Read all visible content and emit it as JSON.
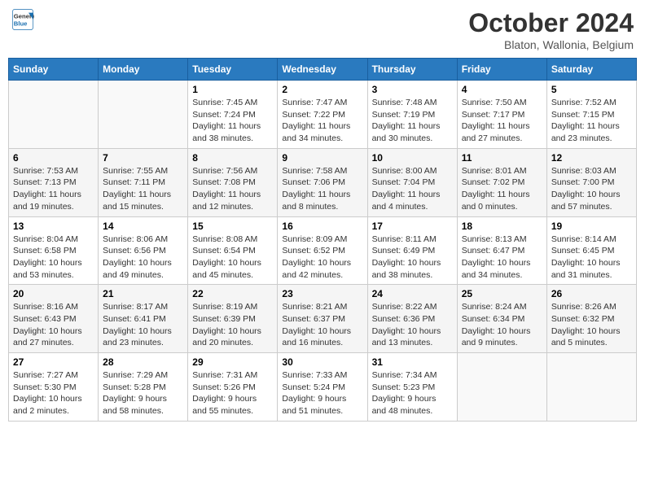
{
  "header": {
    "logo_line1": "General",
    "logo_line2": "Blue",
    "month": "October 2024",
    "location": "Blaton, Wallonia, Belgium"
  },
  "weekdays": [
    "Sunday",
    "Monday",
    "Tuesday",
    "Wednesday",
    "Thursday",
    "Friday",
    "Saturday"
  ],
  "weeks": [
    [
      {
        "day": "",
        "sunrise": "",
        "sunset": "",
        "daylight": ""
      },
      {
        "day": "",
        "sunrise": "",
        "sunset": "",
        "daylight": ""
      },
      {
        "day": "1",
        "sunrise": "Sunrise: 7:45 AM",
        "sunset": "Sunset: 7:24 PM",
        "daylight": "Daylight: 11 hours and 38 minutes."
      },
      {
        "day": "2",
        "sunrise": "Sunrise: 7:47 AM",
        "sunset": "Sunset: 7:22 PM",
        "daylight": "Daylight: 11 hours and 34 minutes."
      },
      {
        "day": "3",
        "sunrise": "Sunrise: 7:48 AM",
        "sunset": "Sunset: 7:19 PM",
        "daylight": "Daylight: 11 hours and 30 minutes."
      },
      {
        "day": "4",
        "sunrise": "Sunrise: 7:50 AM",
        "sunset": "Sunset: 7:17 PM",
        "daylight": "Daylight: 11 hours and 27 minutes."
      },
      {
        "day": "5",
        "sunrise": "Sunrise: 7:52 AM",
        "sunset": "Sunset: 7:15 PM",
        "daylight": "Daylight: 11 hours and 23 minutes."
      }
    ],
    [
      {
        "day": "6",
        "sunrise": "Sunrise: 7:53 AM",
        "sunset": "Sunset: 7:13 PM",
        "daylight": "Daylight: 11 hours and 19 minutes."
      },
      {
        "day": "7",
        "sunrise": "Sunrise: 7:55 AM",
        "sunset": "Sunset: 7:11 PM",
        "daylight": "Daylight: 11 hours and 15 minutes."
      },
      {
        "day": "8",
        "sunrise": "Sunrise: 7:56 AM",
        "sunset": "Sunset: 7:08 PM",
        "daylight": "Daylight: 11 hours and 12 minutes."
      },
      {
        "day": "9",
        "sunrise": "Sunrise: 7:58 AM",
        "sunset": "Sunset: 7:06 PM",
        "daylight": "Daylight: 11 hours and 8 minutes."
      },
      {
        "day": "10",
        "sunrise": "Sunrise: 8:00 AM",
        "sunset": "Sunset: 7:04 PM",
        "daylight": "Daylight: 11 hours and 4 minutes."
      },
      {
        "day": "11",
        "sunrise": "Sunrise: 8:01 AM",
        "sunset": "Sunset: 7:02 PM",
        "daylight": "Daylight: 11 hours and 0 minutes."
      },
      {
        "day": "12",
        "sunrise": "Sunrise: 8:03 AM",
        "sunset": "Sunset: 7:00 PM",
        "daylight": "Daylight: 10 hours and 57 minutes."
      }
    ],
    [
      {
        "day": "13",
        "sunrise": "Sunrise: 8:04 AM",
        "sunset": "Sunset: 6:58 PM",
        "daylight": "Daylight: 10 hours and 53 minutes."
      },
      {
        "day": "14",
        "sunrise": "Sunrise: 8:06 AM",
        "sunset": "Sunset: 6:56 PM",
        "daylight": "Daylight: 10 hours and 49 minutes."
      },
      {
        "day": "15",
        "sunrise": "Sunrise: 8:08 AM",
        "sunset": "Sunset: 6:54 PM",
        "daylight": "Daylight: 10 hours and 45 minutes."
      },
      {
        "day": "16",
        "sunrise": "Sunrise: 8:09 AM",
        "sunset": "Sunset: 6:52 PM",
        "daylight": "Daylight: 10 hours and 42 minutes."
      },
      {
        "day": "17",
        "sunrise": "Sunrise: 8:11 AM",
        "sunset": "Sunset: 6:49 PM",
        "daylight": "Daylight: 10 hours and 38 minutes."
      },
      {
        "day": "18",
        "sunrise": "Sunrise: 8:13 AM",
        "sunset": "Sunset: 6:47 PM",
        "daylight": "Daylight: 10 hours and 34 minutes."
      },
      {
        "day": "19",
        "sunrise": "Sunrise: 8:14 AM",
        "sunset": "Sunset: 6:45 PM",
        "daylight": "Daylight: 10 hours and 31 minutes."
      }
    ],
    [
      {
        "day": "20",
        "sunrise": "Sunrise: 8:16 AM",
        "sunset": "Sunset: 6:43 PM",
        "daylight": "Daylight: 10 hours and 27 minutes."
      },
      {
        "day": "21",
        "sunrise": "Sunrise: 8:17 AM",
        "sunset": "Sunset: 6:41 PM",
        "daylight": "Daylight: 10 hours and 23 minutes."
      },
      {
        "day": "22",
        "sunrise": "Sunrise: 8:19 AM",
        "sunset": "Sunset: 6:39 PM",
        "daylight": "Daylight: 10 hours and 20 minutes."
      },
      {
        "day": "23",
        "sunrise": "Sunrise: 8:21 AM",
        "sunset": "Sunset: 6:37 PM",
        "daylight": "Daylight: 10 hours and 16 minutes."
      },
      {
        "day": "24",
        "sunrise": "Sunrise: 8:22 AM",
        "sunset": "Sunset: 6:36 PM",
        "daylight": "Daylight: 10 hours and 13 minutes."
      },
      {
        "day": "25",
        "sunrise": "Sunrise: 8:24 AM",
        "sunset": "Sunset: 6:34 PM",
        "daylight": "Daylight: 10 hours and 9 minutes."
      },
      {
        "day": "26",
        "sunrise": "Sunrise: 8:26 AM",
        "sunset": "Sunset: 6:32 PM",
        "daylight": "Daylight: 10 hours and 5 minutes."
      }
    ],
    [
      {
        "day": "27",
        "sunrise": "Sunrise: 7:27 AM",
        "sunset": "Sunset: 5:30 PM",
        "daylight": "Daylight: 10 hours and 2 minutes."
      },
      {
        "day": "28",
        "sunrise": "Sunrise: 7:29 AM",
        "sunset": "Sunset: 5:28 PM",
        "daylight": "Daylight: 9 hours and 58 minutes."
      },
      {
        "day": "29",
        "sunrise": "Sunrise: 7:31 AM",
        "sunset": "Sunset: 5:26 PM",
        "daylight": "Daylight: 9 hours and 55 minutes."
      },
      {
        "day": "30",
        "sunrise": "Sunrise: 7:33 AM",
        "sunset": "Sunset: 5:24 PM",
        "daylight": "Daylight: 9 hours and 51 minutes."
      },
      {
        "day": "31",
        "sunrise": "Sunrise: 7:34 AM",
        "sunset": "Sunset: 5:23 PM",
        "daylight": "Daylight: 9 hours and 48 minutes."
      },
      {
        "day": "",
        "sunrise": "",
        "sunset": "",
        "daylight": ""
      },
      {
        "day": "",
        "sunrise": "",
        "sunset": "",
        "daylight": ""
      }
    ]
  ]
}
